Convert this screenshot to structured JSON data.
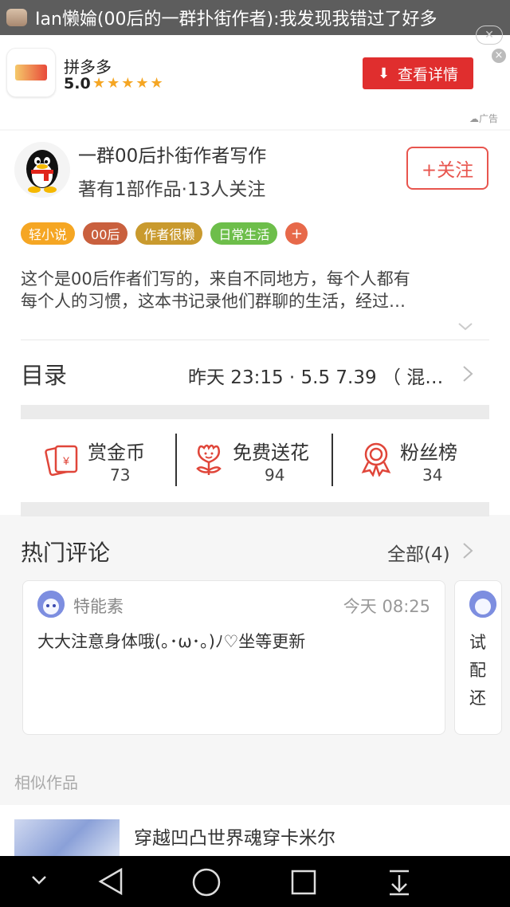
{
  "notification": {
    "text": "Ian懒婨(00后的一群扑街作者):我发现我错过了好多"
  },
  "ad": {
    "app_name": "拼多多",
    "rating": "5.0",
    "stars": "★★★★★",
    "cta_label": "查看详情",
    "ad_label": "广告",
    "close": "×"
  },
  "book": {
    "author_group": "一群00后扑街作者写作",
    "meta": "著有1部作品·13人关注",
    "follow_label": "+关注",
    "tags": [
      {
        "label": "轻小说",
        "color": "#f5a623"
      },
      {
        "label": "00后",
        "color": "#c9603e"
      },
      {
        "label": "作者很懒",
        "color": "#c99a2e"
      },
      {
        "label": "日常生活",
        "color": "#6dbe4a"
      }
    ],
    "tag_add": "+",
    "description_line1": "这个是00后作者们写的，来自不同地方，每个人都有",
    "description_line2": "每个人的习惯，这本书记录他们群聊的生活，经过…",
    "toc_label": "目录",
    "toc_info": "昨天 23:15 · 5.5 7.39 （ 混…",
    "stats": [
      {
        "label": "赏金币",
        "value": "73",
        "icon": "red-envelope-icon"
      },
      {
        "label": "免费送花",
        "value": "94",
        "icon": "flower-icon"
      },
      {
        "label": "粉丝榜",
        "value": "34",
        "icon": "ribbon-medal-icon"
      }
    ]
  },
  "comments": {
    "heading": "热门评论",
    "all_label": "全部(4)",
    "items": [
      {
        "user": "特能素",
        "time": "今天 08:25",
        "body": "大大注意身体哦(｡･ω･｡)ﾉ♡坐等更新"
      }
    ],
    "peek_text": "试配还"
  },
  "similar": {
    "heading": "相似作品",
    "item_title": "穿越凹凸世界魂穿卡米尔"
  },
  "colors": {
    "accent": "#e8554e",
    "ad_button": "#e02e2e"
  }
}
